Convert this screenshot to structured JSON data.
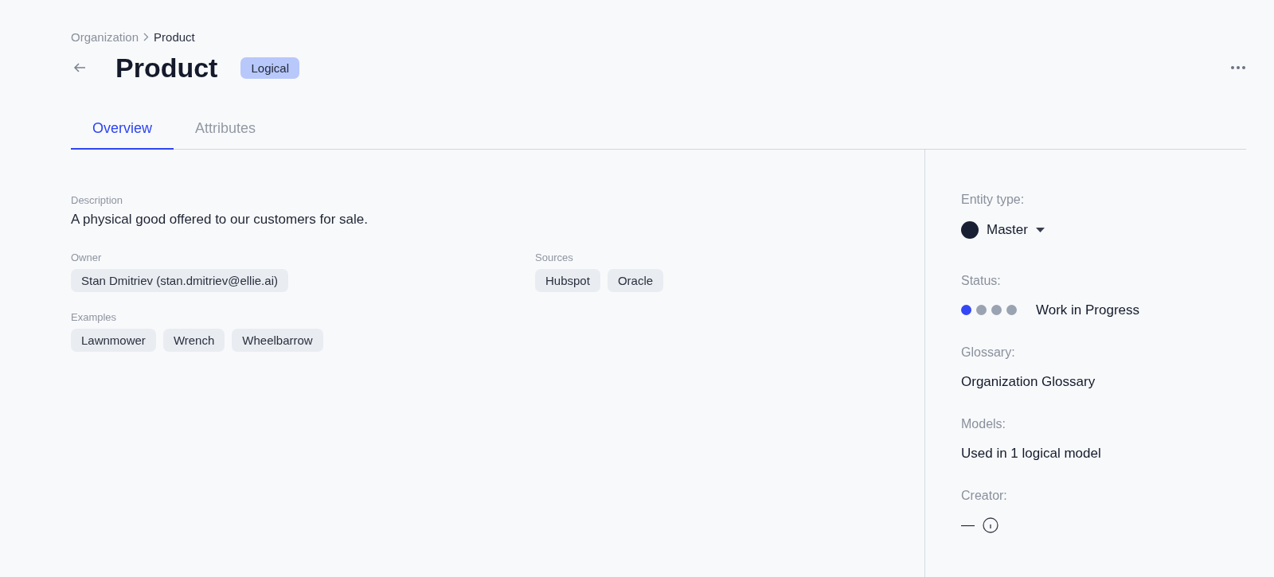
{
  "breadcrumb": [
    {
      "label": "Organization"
    },
    {
      "label": "Product"
    }
  ],
  "title": "Product",
  "badge": "Logical",
  "tabs": [
    {
      "label": "Overview",
      "selected": true
    },
    {
      "label": "Attributes",
      "selected": false
    }
  ],
  "description": {
    "label": "Description",
    "text": "A physical good offered to our customers for sale."
  },
  "owner": {
    "label": "Owner",
    "chips": [
      "Stan Dmitriev (stan.dmitriev@ellie.ai)"
    ]
  },
  "sources": {
    "label": "Sources",
    "chips": [
      "Hubspot",
      "Oracle"
    ]
  },
  "examples": {
    "label": "Examples",
    "chips": [
      "Lawnmower",
      "Wrench",
      "Wheelbarrow"
    ]
  },
  "sidebar": {
    "entity_type": {
      "label": "Entity type:",
      "value": "Master",
      "color": "#1a2033"
    },
    "status": {
      "label": "Status:",
      "stars": 1,
      "value": "Work in Progress"
    },
    "glossary": {
      "label": "Glossary:",
      "value": "Organization Glossary"
    },
    "models": {
      "label": "Models:",
      "value": "Used in 1 logical model"
    },
    "creator": {
      "label": "Creator:",
      "value": "—"
    }
  }
}
